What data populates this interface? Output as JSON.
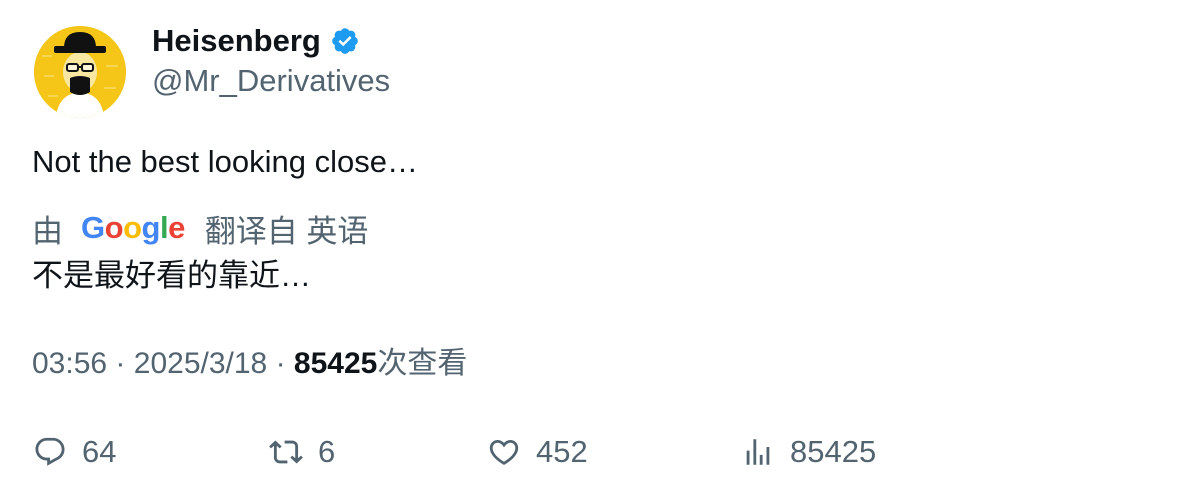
{
  "author": {
    "display_name": "Heisenberg",
    "handle": "@Mr_Derivatives",
    "verified_icon": "verified-badge-icon",
    "avatar_icon": "heisenberg-avatar"
  },
  "tweet": {
    "text": "Not the best looking close…"
  },
  "translation": {
    "prefix": "由",
    "provider": [
      "G",
      "o",
      "o",
      "g",
      "l",
      "e"
    ],
    "suffix": "翻译自 英语",
    "text": "不是最好看的靠近…"
  },
  "meta": {
    "time": "03:56",
    "separator": "·",
    "date": "2025/3/18",
    "views_count": "85425",
    "views_label": "次查看"
  },
  "actions": {
    "replies": "64",
    "retweets": "6",
    "likes": "452",
    "views": "85425"
  },
  "colors": {
    "verified": "#1d9bf0",
    "secondary_text": "#536471",
    "primary_text": "#0f1419",
    "avatar_bg": "#f5c518"
  }
}
